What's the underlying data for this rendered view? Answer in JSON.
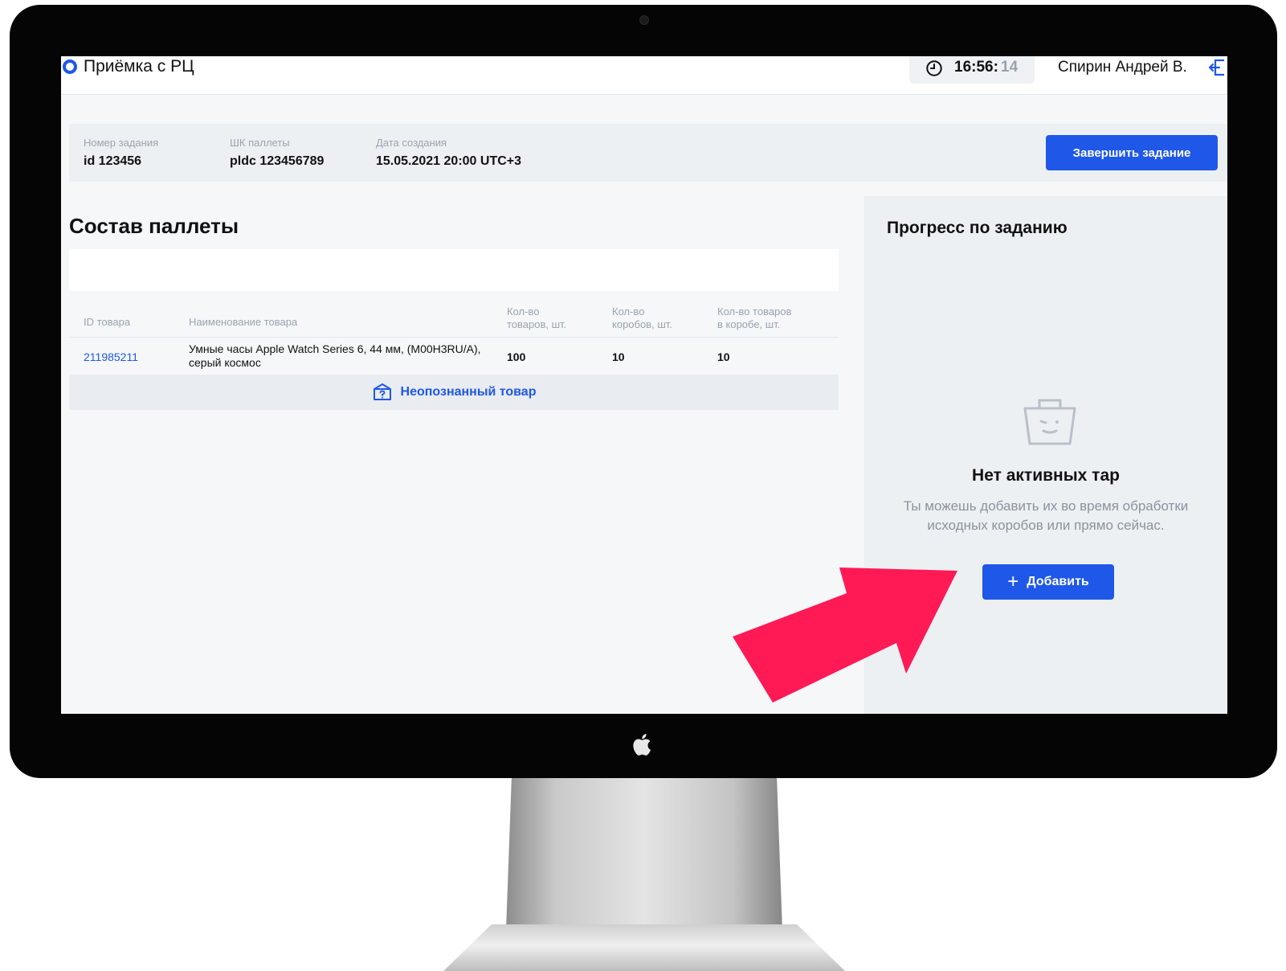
{
  "header": {
    "app_title": "Приёмка с РЦ",
    "clock_hm": "16:56:",
    "clock_s": "14",
    "user_name": "Спирин Андрей В."
  },
  "task": {
    "fields": [
      {
        "label": "Номер задания",
        "value": "id 123456"
      },
      {
        "label": "ШК паллеты",
        "value": "pldc 123456789"
      },
      {
        "label": "Дата создания",
        "value": "15.05.2021 20:00 UTC+3"
      }
    ],
    "finish_label": "Завершить задание"
  },
  "pallet": {
    "title": "Состав паллеты",
    "columns": {
      "id": "ID товара",
      "name": "Наименование товара",
      "qty_items_1": "Кол-во",
      "qty_items_2": "товаров, шт.",
      "qty_boxes_1": "Кол-во",
      "qty_boxes_2": "коробов, шт.",
      "qty_per_box_1": "Кол-во товаров",
      "qty_per_box_2": "в коробе, шт."
    },
    "rows": [
      {
        "id": "211985211",
        "name": "Умные часы Apple Watch Series 6, 44 мм, (M00H3RU/A), серый космос",
        "qty_items": "100",
        "qty_boxes": "10",
        "qty_per_box": "10"
      }
    ],
    "unknown_label": "Неопознанный товар"
  },
  "progress": {
    "title": "Прогресс по заданию",
    "empty_title": "Нет активных тар",
    "empty_desc": "Ты можешь добавить их во время обработки исходных коробов или прямо сейчас.",
    "add_label": "Добавить"
  },
  "icons": {
    "clock": "clock-icon",
    "logout": "logout-icon",
    "unknown_box": "question-box-icon",
    "basket": "basket-icon",
    "plus": "plus-icon",
    "arrow": "arrow-pointer"
  },
  "colors": {
    "accent": "#1f58e8",
    "annotation": "#ff1a55"
  }
}
